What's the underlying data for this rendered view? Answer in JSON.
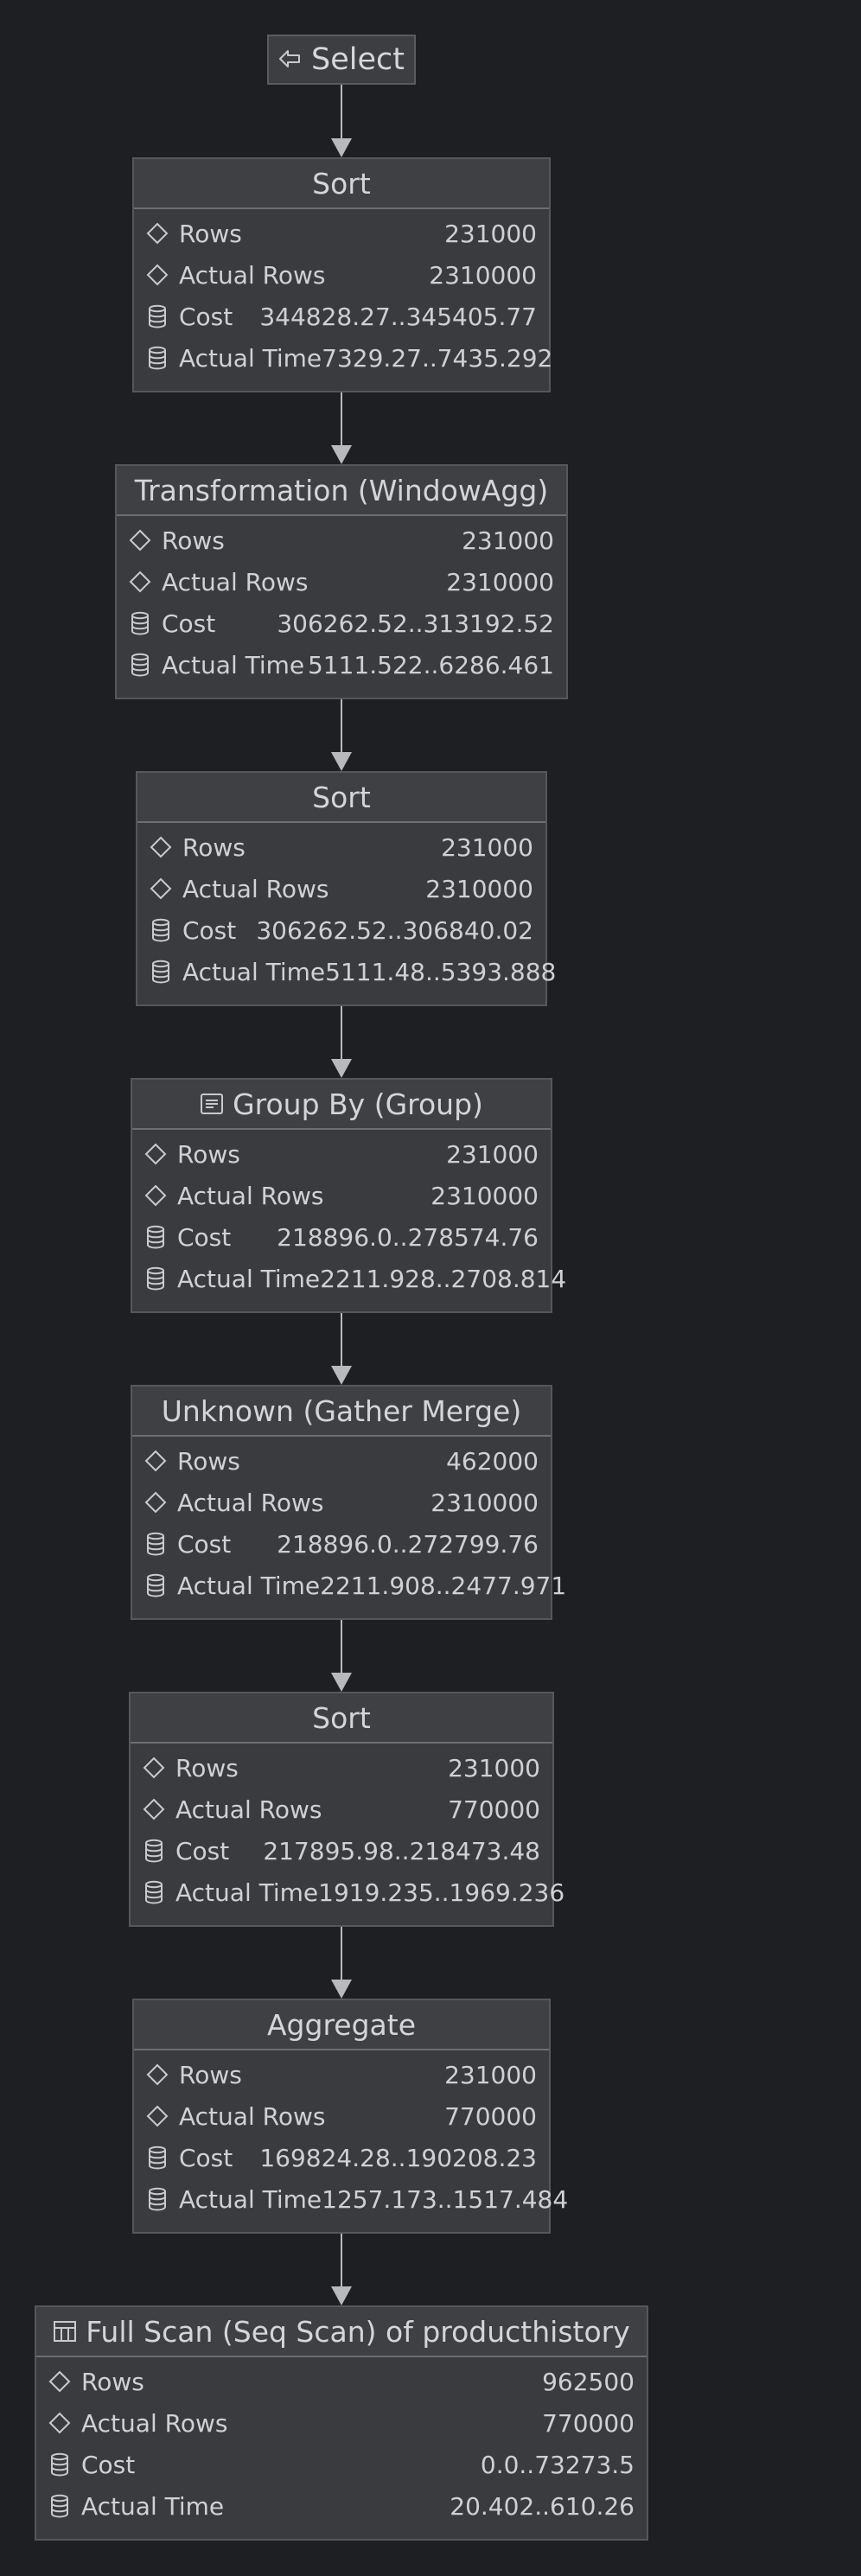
{
  "select_node": {
    "label": "Select",
    "icon": "select-arrow-icon"
  },
  "nodes": [
    {
      "id": "sort-1",
      "title": "Sort",
      "icon": null,
      "rows": [
        {
          "label": "Rows",
          "value": "231000",
          "icon": "diamond-icon"
        },
        {
          "label": "Actual Rows",
          "value": "2310000",
          "icon": "diamond-icon"
        },
        {
          "label": "Cost",
          "value": "344828.27..345405.77",
          "icon": "database-icon"
        },
        {
          "label": "Actual Time",
          "value": "7329.27..7435.292",
          "icon": "database-icon"
        }
      ]
    },
    {
      "id": "windowagg",
      "title": "Transformation (WindowAgg)",
      "icon": null,
      "rows": [
        {
          "label": "Rows",
          "value": "231000",
          "icon": "diamond-icon"
        },
        {
          "label": "Actual Rows",
          "value": "2310000",
          "icon": "diamond-icon"
        },
        {
          "label": "Cost",
          "value": "306262.52..313192.52",
          "icon": "database-icon"
        },
        {
          "label": "Actual Time",
          "value": "5111.522..6286.461",
          "icon": "database-icon"
        }
      ]
    },
    {
      "id": "sort-2",
      "title": "Sort",
      "icon": null,
      "rows": [
        {
          "label": "Rows",
          "value": "231000",
          "icon": "diamond-icon"
        },
        {
          "label": "Actual Rows",
          "value": "2310000",
          "icon": "diamond-icon"
        },
        {
          "label": "Cost",
          "value": "306262.52..306840.02",
          "icon": "database-icon"
        },
        {
          "label": "Actual Time",
          "value": "5111.48..5393.888",
          "icon": "database-icon"
        }
      ]
    },
    {
      "id": "group-by",
      "title": "Group By (Group)",
      "icon": "group-list-icon",
      "rows": [
        {
          "label": "Rows",
          "value": "231000",
          "icon": "diamond-icon"
        },
        {
          "label": "Actual Rows",
          "value": "2310000",
          "icon": "diamond-icon"
        },
        {
          "label": "Cost",
          "value": "218896.0..278574.76",
          "icon": "database-icon"
        },
        {
          "label": "Actual Time",
          "value": "2211.928..2708.814",
          "icon": "database-icon"
        }
      ]
    },
    {
      "id": "gather-merge",
      "title": "Unknown (Gather Merge)",
      "icon": null,
      "rows": [
        {
          "label": "Rows",
          "value": "462000",
          "icon": "diamond-icon"
        },
        {
          "label": "Actual Rows",
          "value": "2310000",
          "icon": "diamond-icon"
        },
        {
          "label": "Cost",
          "value": "218896.0..272799.76",
          "icon": "database-icon"
        },
        {
          "label": "Actual Time",
          "value": "2211.908..2477.971",
          "icon": "database-icon"
        }
      ]
    },
    {
      "id": "sort-3",
      "title": "Sort",
      "icon": null,
      "rows": [
        {
          "label": "Rows",
          "value": "231000",
          "icon": "diamond-icon"
        },
        {
          "label": "Actual Rows",
          "value": "770000",
          "icon": "diamond-icon"
        },
        {
          "label": "Cost",
          "value": "217895.98..218473.48",
          "icon": "database-icon"
        },
        {
          "label": "Actual Time",
          "value": "1919.235..1969.236",
          "icon": "database-icon"
        }
      ]
    },
    {
      "id": "aggregate",
      "title": "Aggregate",
      "icon": null,
      "rows": [
        {
          "label": "Rows",
          "value": "231000",
          "icon": "diamond-icon"
        },
        {
          "label": "Actual Rows",
          "value": "770000",
          "icon": "diamond-icon"
        },
        {
          "label": "Cost",
          "value": "169824.28..190208.23",
          "icon": "database-icon"
        },
        {
          "label": "Actual Time",
          "value": "1257.173..1517.484",
          "icon": "database-icon"
        }
      ]
    },
    {
      "id": "seq-scan",
      "title": "Full Scan (Seq Scan) of producthistory",
      "icon": "table-icon",
      "rows": [
        {
          "label": "Rows",
          "value": "962500",
          "icon": "diamond-icon"
        },
        {
          "label": "Actual Rows",
          "value": "770000",
          "icon": "diamond-icon"
        },
        {
          "label": "Cost",
          "value": "0.0..73273.5",
          "icon": "database-icon"
        },
        {
          "label": "Actual Time",
          "value": "20.402..610.26",
          "icon": "database-icon"
        }
      ]
    }
  ],
  "colors": {
    "background": "#1e1f22",
    "node_fill": "#393b3f",
    "node_border": "#55575b",
    "edge": "#b8b9bc"
  }
}
